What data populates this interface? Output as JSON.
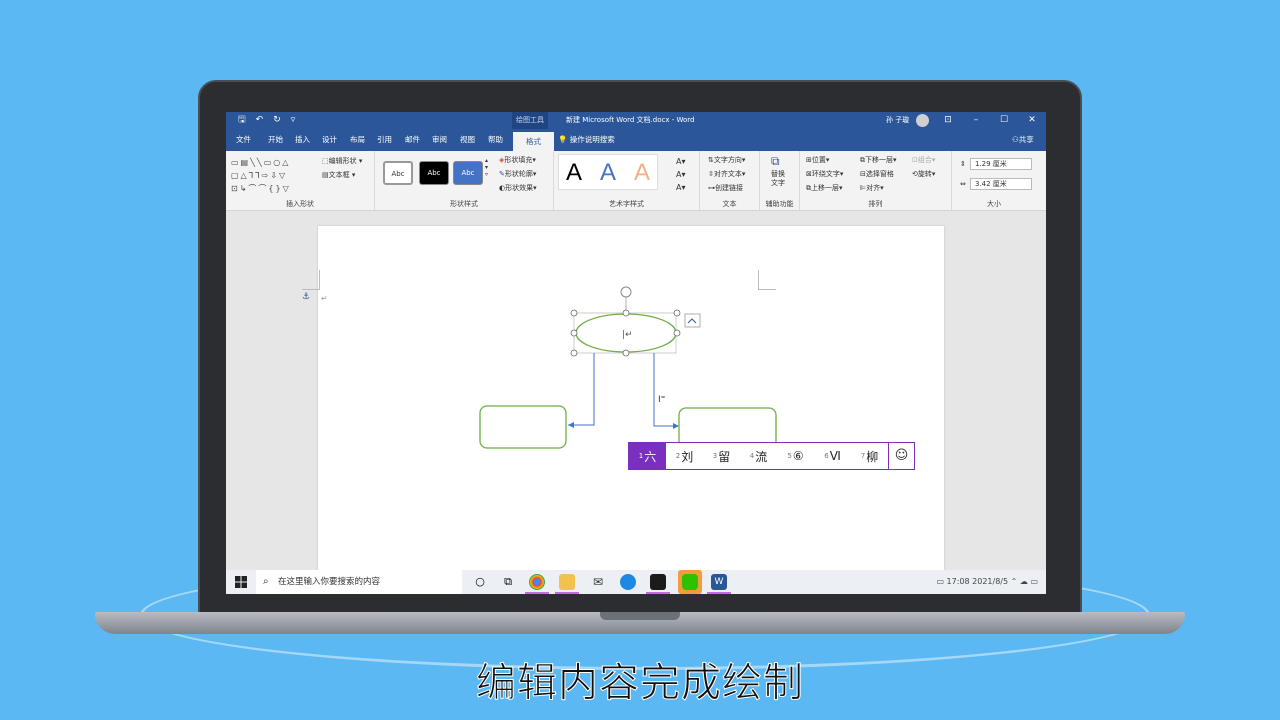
{
  "titlebar": {
    "drawing_tools": "绘图工具",
    "doc_title": "新建 Microsoft Word 文档.docx - Word",
    "user": "孙 子璇"
  },
  "tabs": [
    "文件",
    "开始",
    "插入",
    "设计",
    "布局",
    "引用",
    "邮件",
    "审阅",
    "视图",
    "帮助",
    "格式"
  ],
  "active_tab": "格式",
  "tell_me": "操作说明搜索",
  "share": "共享",
  "ribbon": {
    "insert_shapes": {
      "edit_shape": "编辑形状",
      "text_box": "文本框",
      "label": "插入形状"
    },
    "shape_styles": {
      "swatch1": "Abc",
      "swatch2": "Abc",
      "swatch3": "Abc",
      "fill": "形状填充",
      "outline": "形状轮廓",
      "effects": "形状效果",
      "label": "形状样式"
    },
    "wordart": {
      "a1": "A",
      "a2": "A",
      "a3": "A",
      "label": "艺术字样式"
    },
    "text": {
      "direction": "文字方向",
      "align": "对齐文本",
      "link": "创建链接",
      "label": "文本"
    },
    "accessibility": {
      "alt_text_1": "替换",
      "alt_text_2": "文字",
      "label": "辅助功能"
    },
    "arrange": {
      "position": "位置",
      "wrap": "环绕文字",
      "forward": "上移一层",
      "backward": "下移一层",
      "select_pane": "选择窗格",
      "align": "对齐",
      "group": "组合",
      "rotate": "旋转",
      "label": "排列"
    },
    "size": {
      "height": "1.29 厘米",
      "width": "3.42 厘米",
      "label": "大小"
    }
  },
  "ime": {
    "candidates": [
      {
        "num": "1",
        "text": "六"
      },
      {
        "num": "2",
        "text": "刘"
      },
      {
        "num": "3",
        "text": "留"
      },
      {
        "num": "4",
        "text": "流"
      },
      {
        "num": "5",
        "text": "⑥"
      },
      {
        "num": "6",
        "text": "Ⅵ"
      },
      {
        "num": "7",
        "text": "柳"
      }
    ],
    "emoji": "☺"
  },
  "taskbar": {
    "search_placeholder": "在这里输入你要搜索的内容",
    "time": "17:08",
    "date": "2021/8/5"
  },
  "caption": "编辑内容完成绘制",
  "colors": {
    "word_blue": "#2b579a",
    "ime_purple": "#7b2fbe",
    "shape_green": "#70ad47",
    "connector_blue": "#4472c4",
    "background": "#5cb8f2"
  }
}
